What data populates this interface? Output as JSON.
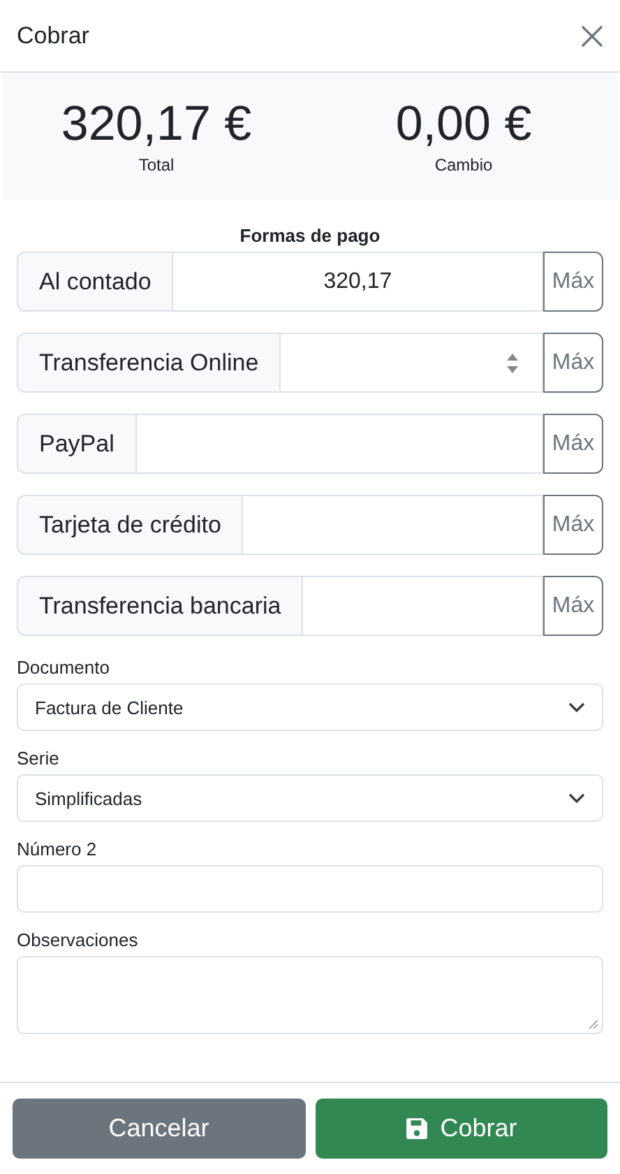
{
  "dialog": {
    "title": "Cobrar"
  },
  "summary": [
    {
      "amount": "320,17 €",
      "label": "Total"
    },
    {
      "amount": "0,00 €",
      "label": "Cambio"
    }
  ],
  "payments_heading": "Formas de pago",
  "payments": [
    {
      "label": "Al contado",
      "value": "320,17",
      "spinner": false,
      "button": "Máx"
    },
    {
      "label": "Transferencia Online",
      "spinner": true,
      "button": "Máx"
    },
    {
      "label": "PayPal",
      "spinner": false,
      "button": "Máx"
    },
    {
      "label": "Tarjeta de crédito",
      "spinner": false,
      "button": "Máx"
    },
    {
      "label": "Transferencia bancaria",
      "spinner": false,
      "button": "Máx"
    }
  ],
  "fields": [
    {
      "kind": "select",
      "label": "Documento",
      "value": "Factura de Cliente"
    },
    {
      "kind": "select",
      "label": "Serie",
      "value": "Simplificadas"
    },
    {
      "kind": "input",
      "label": "Número 2"
    },
    {
      "kind": "textarea",
      "label": "Observaciones"
    }
  ],
  "buttons": [
    {
      "kind": "secondary",
      "label": "Cancelar"
    },
    {
      "kind": "primary",
      "label": "Cobrar"
    }
  ]
}
